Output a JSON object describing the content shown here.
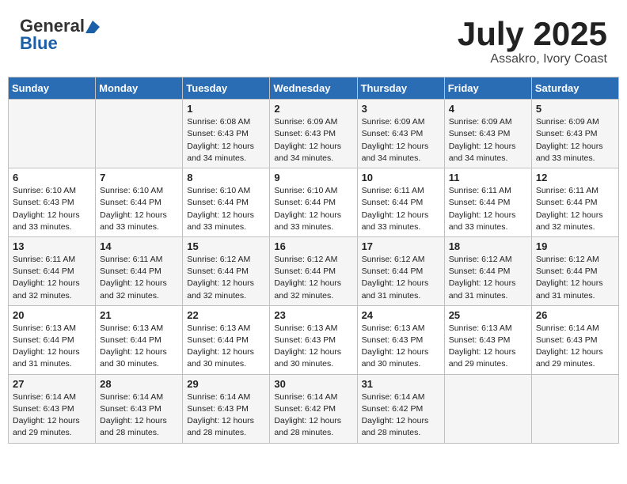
{
  "header": {
    "logo_general": "General",
    "logo_blue": "Blue",
    "title": "July 2025",
    "location": "Assakro, Ivory Coast"
  },
  "days_of_week": [
    "Sunday",
    "Monday",
    "Tuesday",
    "Wednesday",
    "Thursday",
    "Friday",
    "Saturday"
  ],
  "weeks": [
    [
      {
        "day": "",
        "info": ""
      },
      {
        "day": "",
        "info": ""
      },
      {
        "day": "1",
        "info": "Sunrise: 6:08 AM\nSunset: 6:43 PM\nDaylight: 12 hours and 34 minutes."
      },
      {
        "day": "2",
        "info": "Sunrise: 6:09 AM\nSunset: 6:43 PM\nDaylight: 12 hours and 34 minutes."
      },
      {
        "day": "3",
        "info": "Sunrise: 6:09 AM\nSunset: 6:43 PM\nDaylight: 12 hours and 34 minutes."
      },
      {
        "day": "4",
        "info": "Sunrise: 6:09 AM\nSunset: 6:43 PM\nDaylight: 12 hours and 34 minutes."
      },
      {
        "day": "5",
        "info": "Sunrise: 6:09 AM\nSunset: 6:43 PM\nDaylight: 12 hours and 33 minutes."
      }
    ],
    [
      {
        "day": "6",
        "info": "Sunrise: 6:10 AM\nSunset: 6:43 PM\nDaylight: 12 hours and 33 minutes."
      },
      {
        "day": "7",
        "info": "Sunrise: 6:10 AM\nSunset: 6:44 PM\nDaylight: 12 hours and 33 minutes."
      },
      {
        "day": "8",
        "info": "Sunrise: 6:10 AM\nSunset: 6:44 PM\nDaylight: 12 hours and 33 minutes."
      },
      {
        "day": "9",
        "info": "Sunrise: 6:10 AM\nSunset: 6:44 PM\nDaylight: 12 hours and 33 minutes."
      },
      {
        "day": "10",
        "info": "Sunrise: 6:11 AM\nSunset: 6:44 PM\nDaylight: 12 hours and 33 minutes."
      },
      {
        "day": "11",
        "info": "Sunrise: 6:11 AM\nSunset: 6:44 PM\nDaylight: 12 hours and 33 minutes."
      },
      {
        "day": "12",
        "info": "Sunrise: 6:11 AM\nSunset: 6:44 PM\nDaylight: 12 hours and 32 minutes."
      }
    ],
    [
      {
        "day": "13",
        "info": "Sunrise: 6:11 AM\nSunset: 6:44 PM\nDaylight: 12 hours and 32 minutes."
      },
      {
        "day": "14",
        "info": "Sunrise: 6:11 AM\nSunset: 6:44 PM\nDaylight: 12 hours and 32 minutes."
      },
      {
        "day": "15",
        "info": "Sunrise: 6:12 AM\nSunset: 6:44 PM\nDaylight: 12 hours and 32 minutes."
      },
      {
        "day": "16",
        "info": "Sunrise: 6:12 AM\nSunset: 6:44 PM\nDaylight: 12 hours and 32 minutes."
      },
      {
        "day": "17",
        "info": "Sunrise: 6:12 AM\nSunset: 6:44 PM\nDaylight: 12 hours and 31 minutes."
      },
      {
        "day": "18",
        "info": "Sunrise: 6:12 AM\nSunset: 6:44 PM\nDaylight: 12 hours and 31 minutes."
      },
      {
        "day": "19",
        "info": "Sunrise: 6:12 AM\nSunset: 6:44 PM\nDaylight: 12 hours and 31 minutes."
      }
    ],
    [
      {
        "day": "20",
        "info": "Sunrise: 6:13 AM\nSunset: 6:44 PM\nDaylight: 12 hours and 31 minutes."
      },
      {
        "day": "21",
        "info": "Sunrise: 6:13 AM\nSunset: 6:44 PM\nDaylight: 12 hours and 30 minutes."
      },
      {
        "day": "22",
        "info": "Sunrise: 6:13 AM\nSunset: 6:44 PM\nDaylight: 12 hours and 30 minutes."
      },
      {
        "day": "23",
        "info": "Sunrise: 6:13 AM\nSunset: 6:43 PM\nDaylight: 12 hours and 30 minutes."
      },
      {
        "day": "24",
        "info": "Sunrise: 6:13 AM\nSunset: 6:43 PM\nDaylight: 12 hours and 30 minutes."
      },
      {
        "day": "25",
        "info": "Sunrise: 6:13 AM\nSunset: 6:43 PM\nDaylight: 12 hours and 29 minutes."
      },
      {
        "day": "26",
        "info": "Sunrise: 6:14 AM\nSunset: 6:43 PM\nDaylight: 12 hours and 29 minutes."
      }
    ],
    [
      {
        "day": "27",
        "info": "Sunrise: 6:14 AM\nSunset: 6:43 PM\nDaylight: 12 hours and 29 minutes."
      },
      {
        "day": "28",
        "info": "Sunrise: 6:14 AM\nSunset: 6:43 PM\nDaylight: 12 hours and 28 minutes."
      },
      {
        "day": "29",
        "info": "Sunrise: 6:14 AM\nSunset: 6:43 PM\nDaylight: 12 hours and 28 minutes."
      },
      {
        "day": "30",
        "info": "Sunrise: 6:14 AM\nSunset: 6:42 PM\nDaylight: 12 hours and 28 minutes."
      },
      {
        "day": "31",
        "info": "Sunrise: 6:14 AM\nSunset: 6:42 PM\nDaylight: 12 hours and 28 minutes."
      },
      {
        "day": "",
        "info": ""
      },
      {
        "day": "",
        "info": ""
      }
    ]
  ]
}
